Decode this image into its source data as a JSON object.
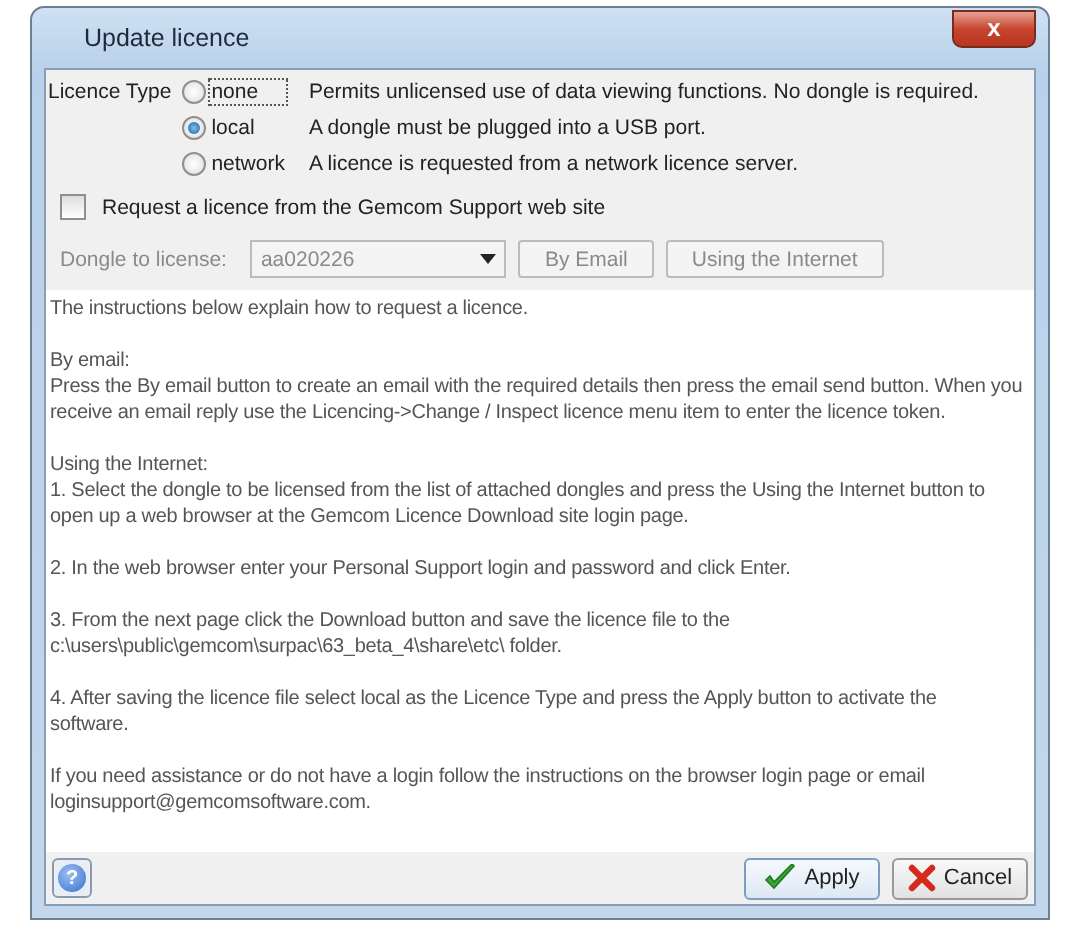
{
  "window": {
    "title": "Update licence",
    "close_label": "x"
  },
  "licence_type": {
    "label": "Licence Type",
    "options": [
      {
        "label": "none",
        "description": "Permits unlicensed use of data viewing functions.  No dongle is required.",
        "selected": false,
        "focused": true
      },
      {
        "label": "local",
        "description": "A dongle must be plugged into a USB port.",
        "selected": true,
        "focused": false
      },
      {
        "label": "network",
        "description": "A licence is requested from a network licence server.",
        "selected": false,
        "focused": false
      }
    ]
  },
  "request_checkbox": {
    "label": "Request a licence from the Gemcom Support web site",
    "checked": false
  },
  "dongle_row": {
    "label": "Dongle to license:",
    "value": "aa020226",
    "disabled": true,
    "buttons": [
      "By Email",
      "Using the Internet"
    ]
  },
  "instructions": [
    [
      "The instructions below explain how to request a licence."
    ],
    [
      "By email:",
      "Press the By email button to create an email with the required details then press the email send button.  When you",
      "receive an email reply use the Licencing->Change / Inspect licence menu item to enter the licence token."
    ],
    [
      "Using the Internet:",
      "1. Select the dongle to be licensed from the list of attached dongles and press the Using the Internet button to",
      "open up a web browser at the Gemcom Licence Download site login page."
    ],
    [
      "2. In the web browser enter your Personal Support login and password and click Enter."
    ],
    [
      "3. From the next page click the Download button and save the licence file to the",
      "c:\\users\\public\\gemcom\\surpac\\63_beta_4\\share\\etc\\ folder."
    ],
    [
      "4. After saving the licence file select local as the Licence Type and press the Apply button to activate the",
      "software."
    ],
    [
      "If you need assistance or do not have a login follow the instructions on the browser login page or email",
      "loginsupport@gemcomsoftware.com."
    ]
  ],
  "footer": {
    "help_label": "?",
    "buttons": [
      {
        "label": "Apply",
        "kind": "apply"
      },
      {
        "label": "Cancel",
        "kind": "cancel"
      }
    ]
  }
}
